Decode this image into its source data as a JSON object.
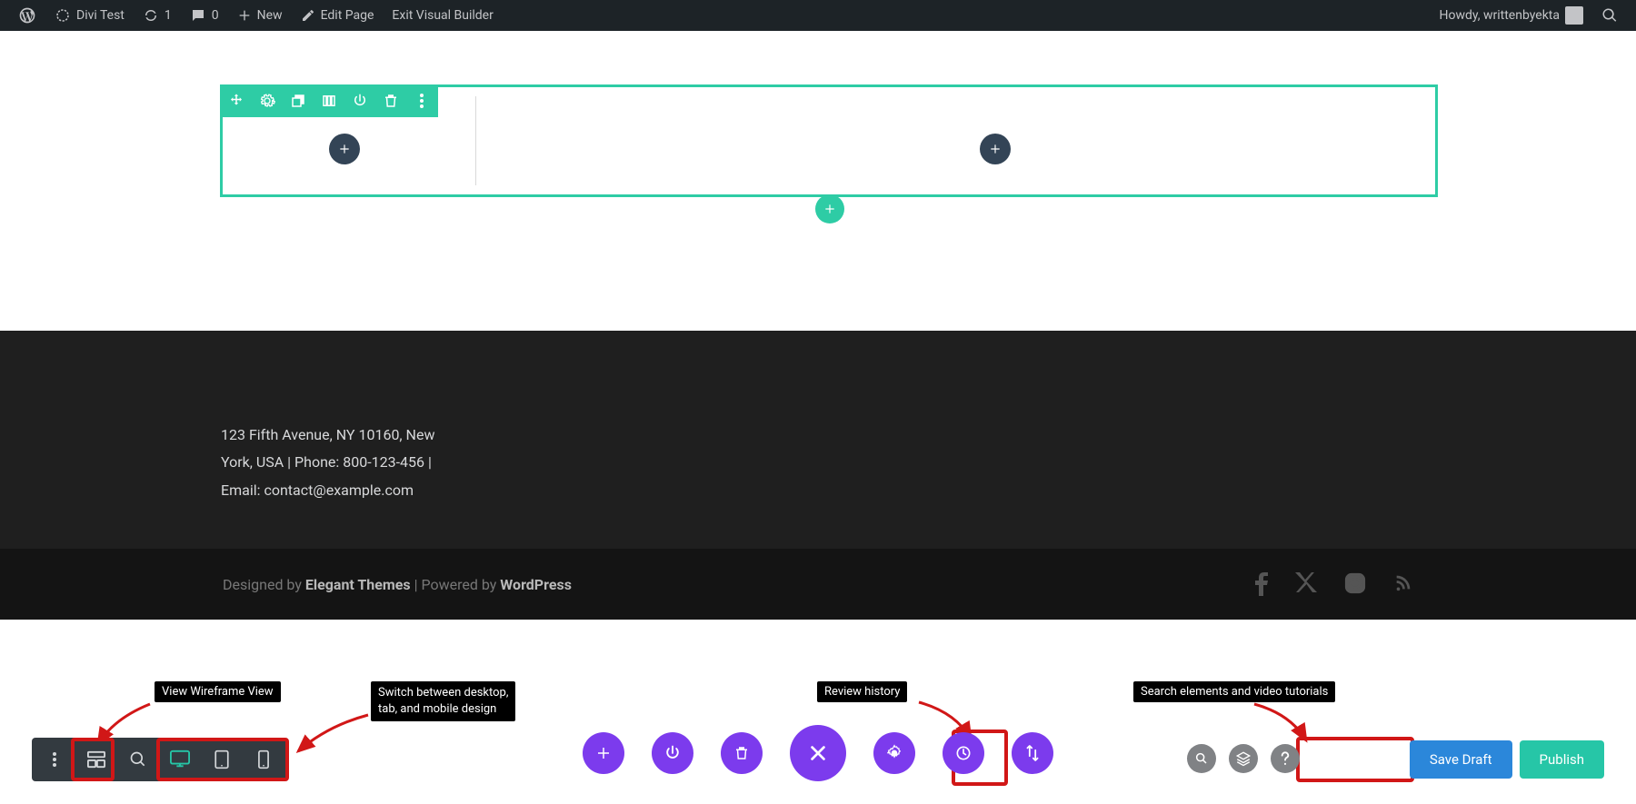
{
  "adminbar": {
    "site_title": "Divi Test",
    "updates_count": "1",
    "comments_count": "0",
    "new_label": "New",
    "edit_page": "Edit Page",
    "exit_vb": "Exit Visual Builder",
    "howdy": "Howdy, writtenbyekta"
  },
  "footer": {
    "line1": "123 Fifth Avenue, NY 10160, New",
    "line2": "York, USA | Phone: 800-123-456 |",
    "line3": "Email: contact@example.com",
    "designed_prefix": "Designed by ",
    "designed_brand": "Elegant Themes",
    "powered_sep": " | Powered by ",
    "powered_brand": "WordPress"
  },
  "annotations": {
    "wireframe": "View Wireframe View",
    "responsive": "Switch between desktop,\ntab, and mobile design",
    "history": "Review history",
    "search": "Search elements and video tutorials"
  },
  "builder": {
    "save_draft": "Save Draft",
    "publish": "Publish"
  }
}
